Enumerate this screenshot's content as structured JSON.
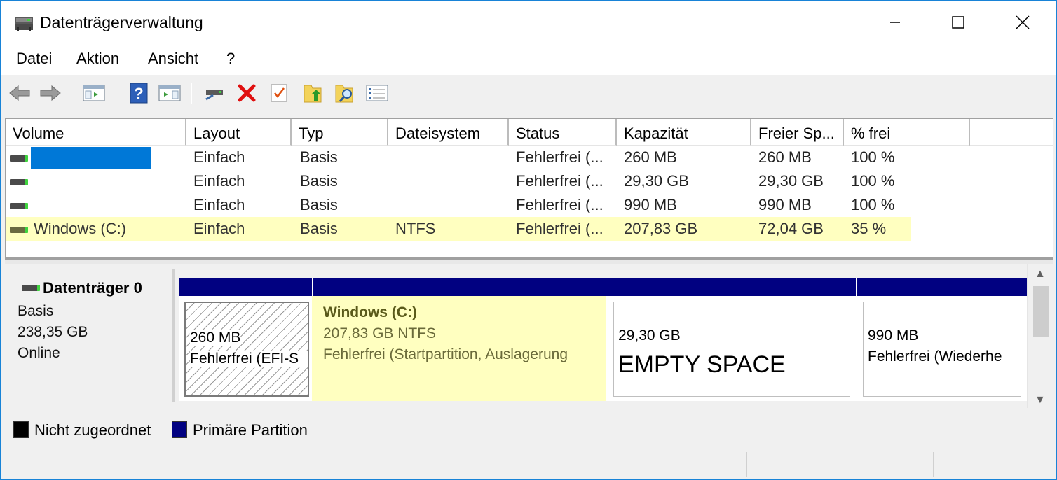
{
  "window": {
    "title": "Datenträgerverwaltung"
  },
  "menu": [
    "Datei",
    "Aktion",
    "Ansicht",
    "?"
  ],
  "toolbar": {
    "icons": [
      "back-arrow-icon",
      "forward-arrow-icon",
      "console-tree-icon",
      "help-icon",
      "action-pane-icon",
      "connect-disk-icon",
      "delete-icon",
      "properties-icon",
      "rescan-icon",
      "search-volume-icon",
      "list-view-icon"
    ]
  },
  "volume_list": {
    "columns": [
      "Volume",
      "Layout",
      "Typ",
      "Dateisystem",
      "Status",
      "Kapazität",
      "Freier Sp...",
      "% frei"
    ],
    "rows": [
      {
        "volume": "",
        "layout": "Einfach",
        "typ": "Basis",
        "dateisystem": "",
        "status": "Fehlerfrei (...",
        "kapazitaet": "260 MB",
        "frei": "260 MB",
        "prozent": "100 %"
      },
      {
        "volume": "",
        "layout": "Einfach",
        "typ": "Basis",
        "dateisystem": "",
        "status": "Fehlerfrei (...",
        "kapazitaet": "29,30 GB",
        "frei": "29,30 GB",
        "prozent": "100 %"
      },
      {
        "volume": "",
        "layout": "Einfach",
        "typ": "Basis",
        "dateisystem": "",
        "status": "Fehlerfrei (...",
        "kapazitaet": "990 MB",
        "frei": "990 MB",
        "prozent": "100 %"
      },
      {
        "volume": "Windows (C:)",
        "layout": "Einfach",
        "typ": "Basis",
        "dateisystem": "NTFS",
        "status": "Fehlerfrei (...",
        "kapazitaet": "207,83 GB",
        "frei": "72,04 GB",
        "prozent": "35 %"
      }
    ]
  },
  "disk": {
    "name": "Datenträger 0",
    "type": "Basis",
    "size": "238,35 GB",
    "state": "Online",
    "partitions": [
      {
        "size": "260 MB",
        "status": "Fehlerfrei (EFI-S"
      },
      {
        "name": "Windows  (C:)",
        "size_fs": "207,83 GB NTFS",
        "status": "Fehlerfrei (Startpartition, Auslagerung"
      },
      {
        "size": "29,30 GB",
        "label": "EMPTY SPACE"
      },
      {
        "size": "990 MB",
        "status": "Fehlerfrei (Wiederhe"
      }
    ]
  },
  "legend": [
    {
      "label": "Nicht zugeordnet",
      "color": "#000000"
    },
    {
      "label": "Primäre Partition",
      "color": "#010181"
    }
  ],
  "colors": {
    "accent": "#1883d7",
    "selected": "#ffffc0",
    "primary_partition": "#010181"
  }
}
